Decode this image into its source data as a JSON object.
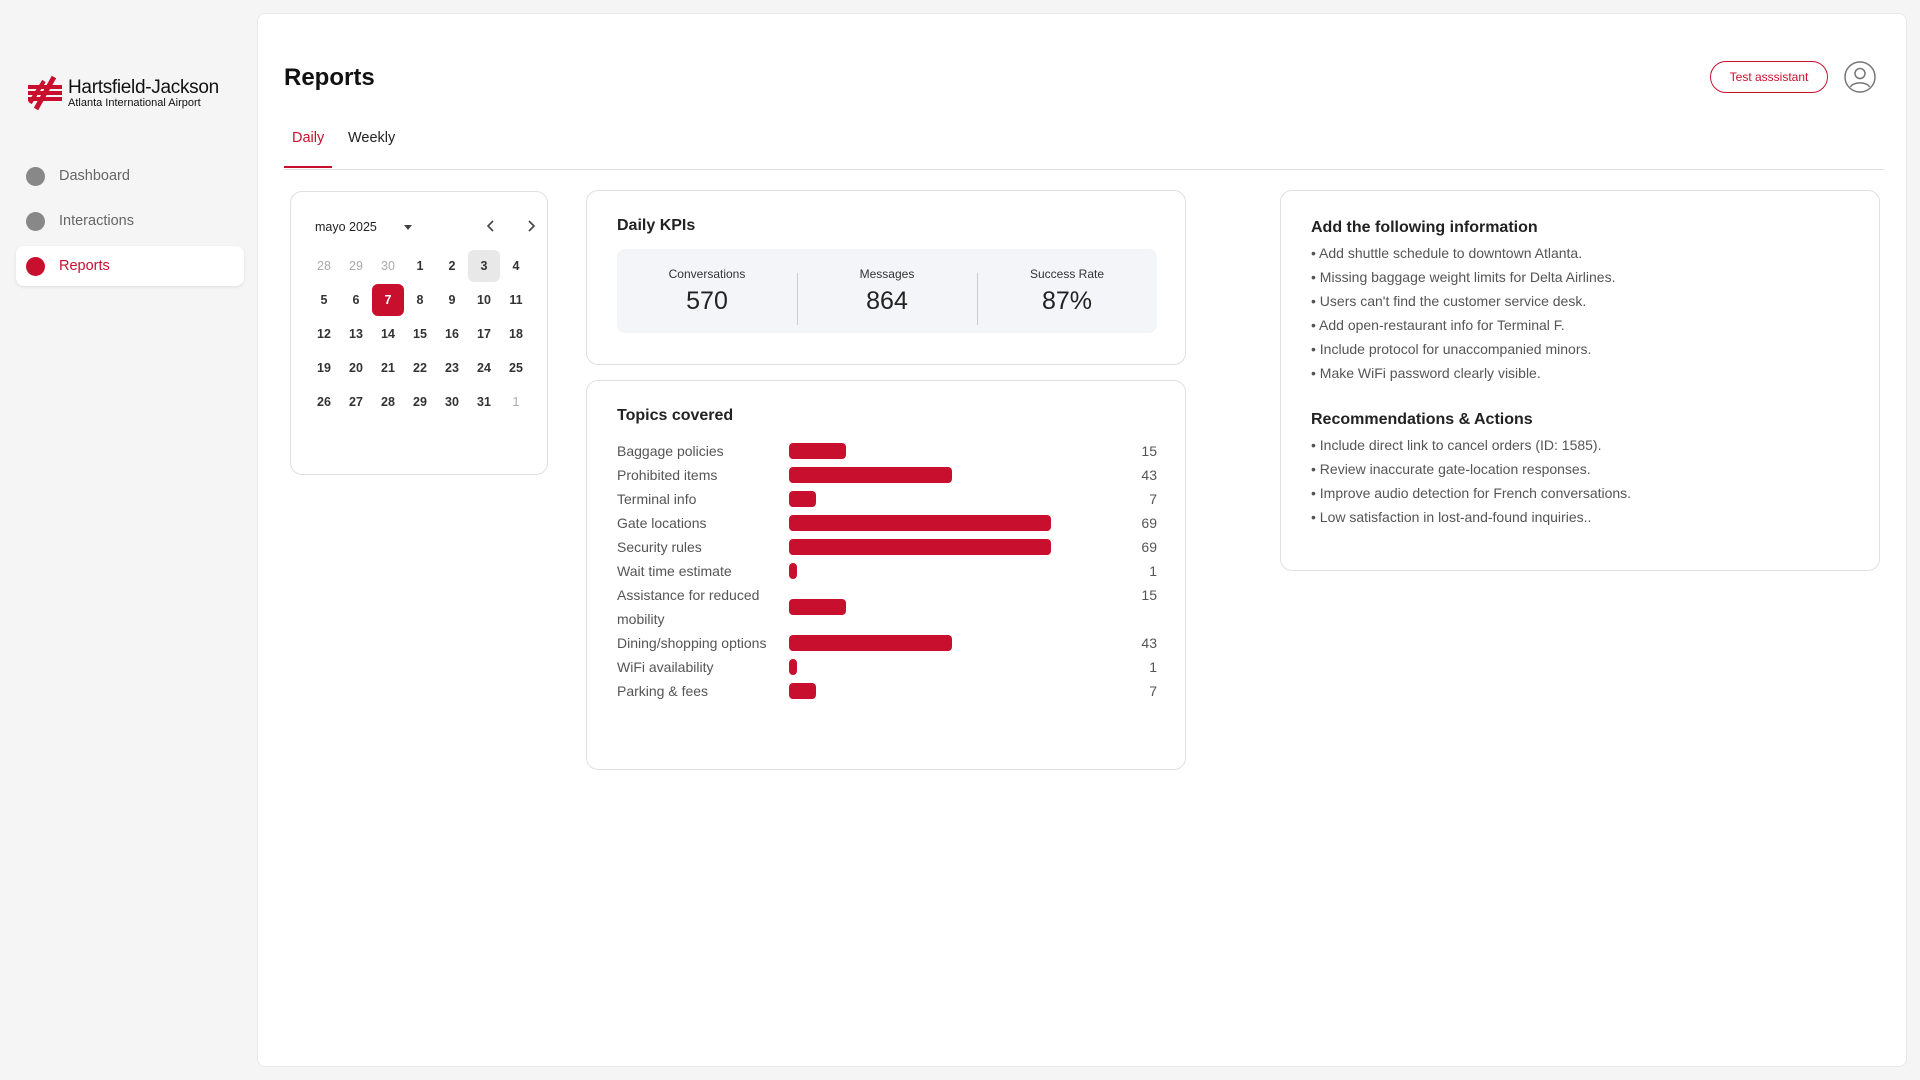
{
  "brand": {
    "name": "Hartsfield-Jackson",
    "subtitle": "Atlanta International Airport",
    "accent": "#c8102e"
  },
  "sidebar": {
    "items": [
      {
        "label": "Dashboard",
        "active": false
      },
      {
        "label": "Interactions",
        "active": false
      },
      {
        "label": "Reports",
        "active": true
      }
    ]
  },
  "header": {
    "title": "Reports",
    "test_button": "Test asssistant",
    "avatar_icon": "user-circle-icon"
  },
  "tabs": [
    {
      "label": "Daily",
      "active": true
    },
    {
      "label": "Weekly",
      "active": false
    }
  ],
  "calendar": {
    "month_label": "mayo 2025",
    "days": [
      {
        "d": "28",
        "muted": true
      },
      {
        "d": "29",
        "muted": true
      },
      {
        "d": "30",
        "muted": true
      },
      {
        "d": "1"
      },
      {
        "d": "2"
      },
      {
        "d": "3",
        "today": true
      },
      {
        "d": "4"
      },
      {
        "d": "5"
      },
      {
        "d": "6"
      },
      {
        "d": "7",
        "selected": true
      },
      {
        "d": "8"
      },
      {
        "d": "9"
      },
      {
        "d": "10"
      },
      {
        "d": "11"
      },
      {
        "d": "12"
      },
      {
        "d": "13"
      },
      {
        "d": "14"
      },
      {
        "d": "15"
      },
      {
        "d": "16"
      },
      {
        "d": "17"
      },
      {
        "d": "18"
      },
      {
        "d": "19"
      },
      {
        "d": "20"
      },
      {
        "d": "21"
      },
      {
        "d": "22"
      },
      {
        "d": "23"
      },
      {
        "d": "24"
      },
      {
        "d": "25"
      },
      {
        "d": "26"
      },
      {
        "d": "27"
      },
      {
        "d": "28"
      },
      {
        "d": "29"
      },
      {
        "d": "30"
      },
      {
        "d": "31"
      },
      {
        "d": "1",
        "muted": true
      }
    ]
  },
  "kpis": {
    "title": "Daily KPIs",
    "items": [
      {
        "label": "Conversations",
        "value": "570"
      },
      {
        "label": "Messages",
        "value": "864"
      },
      {
        "label": "Success Rate",
        "value": "87%"
      }
    ]
  },
  "topics": {
    "title": "Topics covered",
    "max": 69,
    "items": [
      {
        "label": "Baggage policies",
        "count": 15
      },
      {
        "label": "Prohibited items",
        "count": 43
      },
      {
        "label": "Terminal info",
        "count": 7
      },
      {
        "label": "Gate locations",
        "count": 69
      },
      {
        "label": "Security rules",
        "count": 69
      },
      {
        "label": "Wait time estimate",
        "count": 1
      },
      {
        "label": "Assistance for reduced mobility",
        "count": 15
      },
      {
        "label": "Dining/shopping options",
        "count": 43
      },
      {
        "label": "WiFi availability",
        "count": 1
      },
      {
        "label": "Parking & fees",
        "count": 7
      }
    ]
  },
  "info": {
    "add_title": "Add the following information",
    "add_items": [
      "• Add shuttle schedule to downtown Atlanta.",
      "• Missing baggage weight limits for Delta Airlines.",
      "• Users can't find the customer service desk.",
      "• Add open-restaurant info for Terminal F.",
      "• Include protocol for unaccompanied minors.",
      "• Make WiFi password clearly visible."
    ],
    "rec_title": "Recommendations & Actions",
    "rec_items": [
      "• Include direct link to cancel orders (ID: 1585).",
      "• Review inaccurate gate-location responses.",
      "• Improve audio detection for French conversations.",
      "• Low satisfaction in lost-and-found inquiries.."
    ]
  }
}
